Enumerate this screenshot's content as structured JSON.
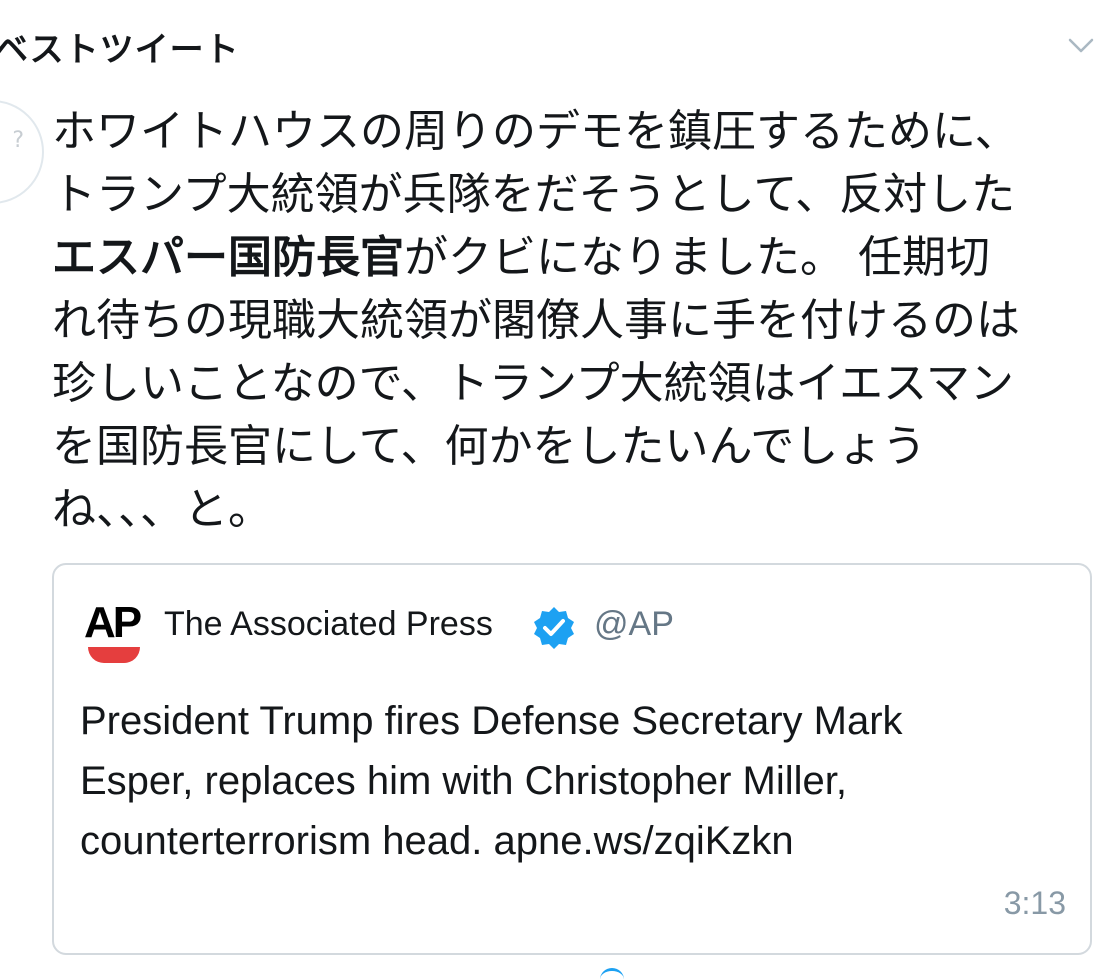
{
  "header": {
    "title": "ベストツイート",
    "chevron_icon": "chevron-down-icon"
  },
  "tweet": {
    "text_before_bold": "ホワイトハウスの周りのデモを鎮圧するために、\nトランプ大統領が兵隊をだそうとして、反対した\n",
    "text_bold": "エスパー国防長官",
    "text_after_bold": "がクビになりました。 任期切\nれ待ちの現職大統領が閣僚人事に手を付けるのは\n珍しいことなので、トランプ大統領はイエスマン\nを国防長官にして、何かをしたいんでしょう\nね、、、と。"
  },
  "quoted_tweet": {
    "logo_text": "AP",
    "author_name": "The Associated Press",
    "verified_icon": "verified-badge-icon",
    "handle": "@AP",
    "body": "President Trump fires Defense Secretary Mark\nEsper, replaces him with Christopher Miller,\ncounterterrorism head. apne.ws/zqiKzkn",
    "time": "3:13"
  },
  "colors": {
    "text": "#14171a",
    "secondary": "#657786",
    "verified": "#1da1f2",
    "ap_red": "#e53e3e",
    "border": "#d3d9de"
  }
}
